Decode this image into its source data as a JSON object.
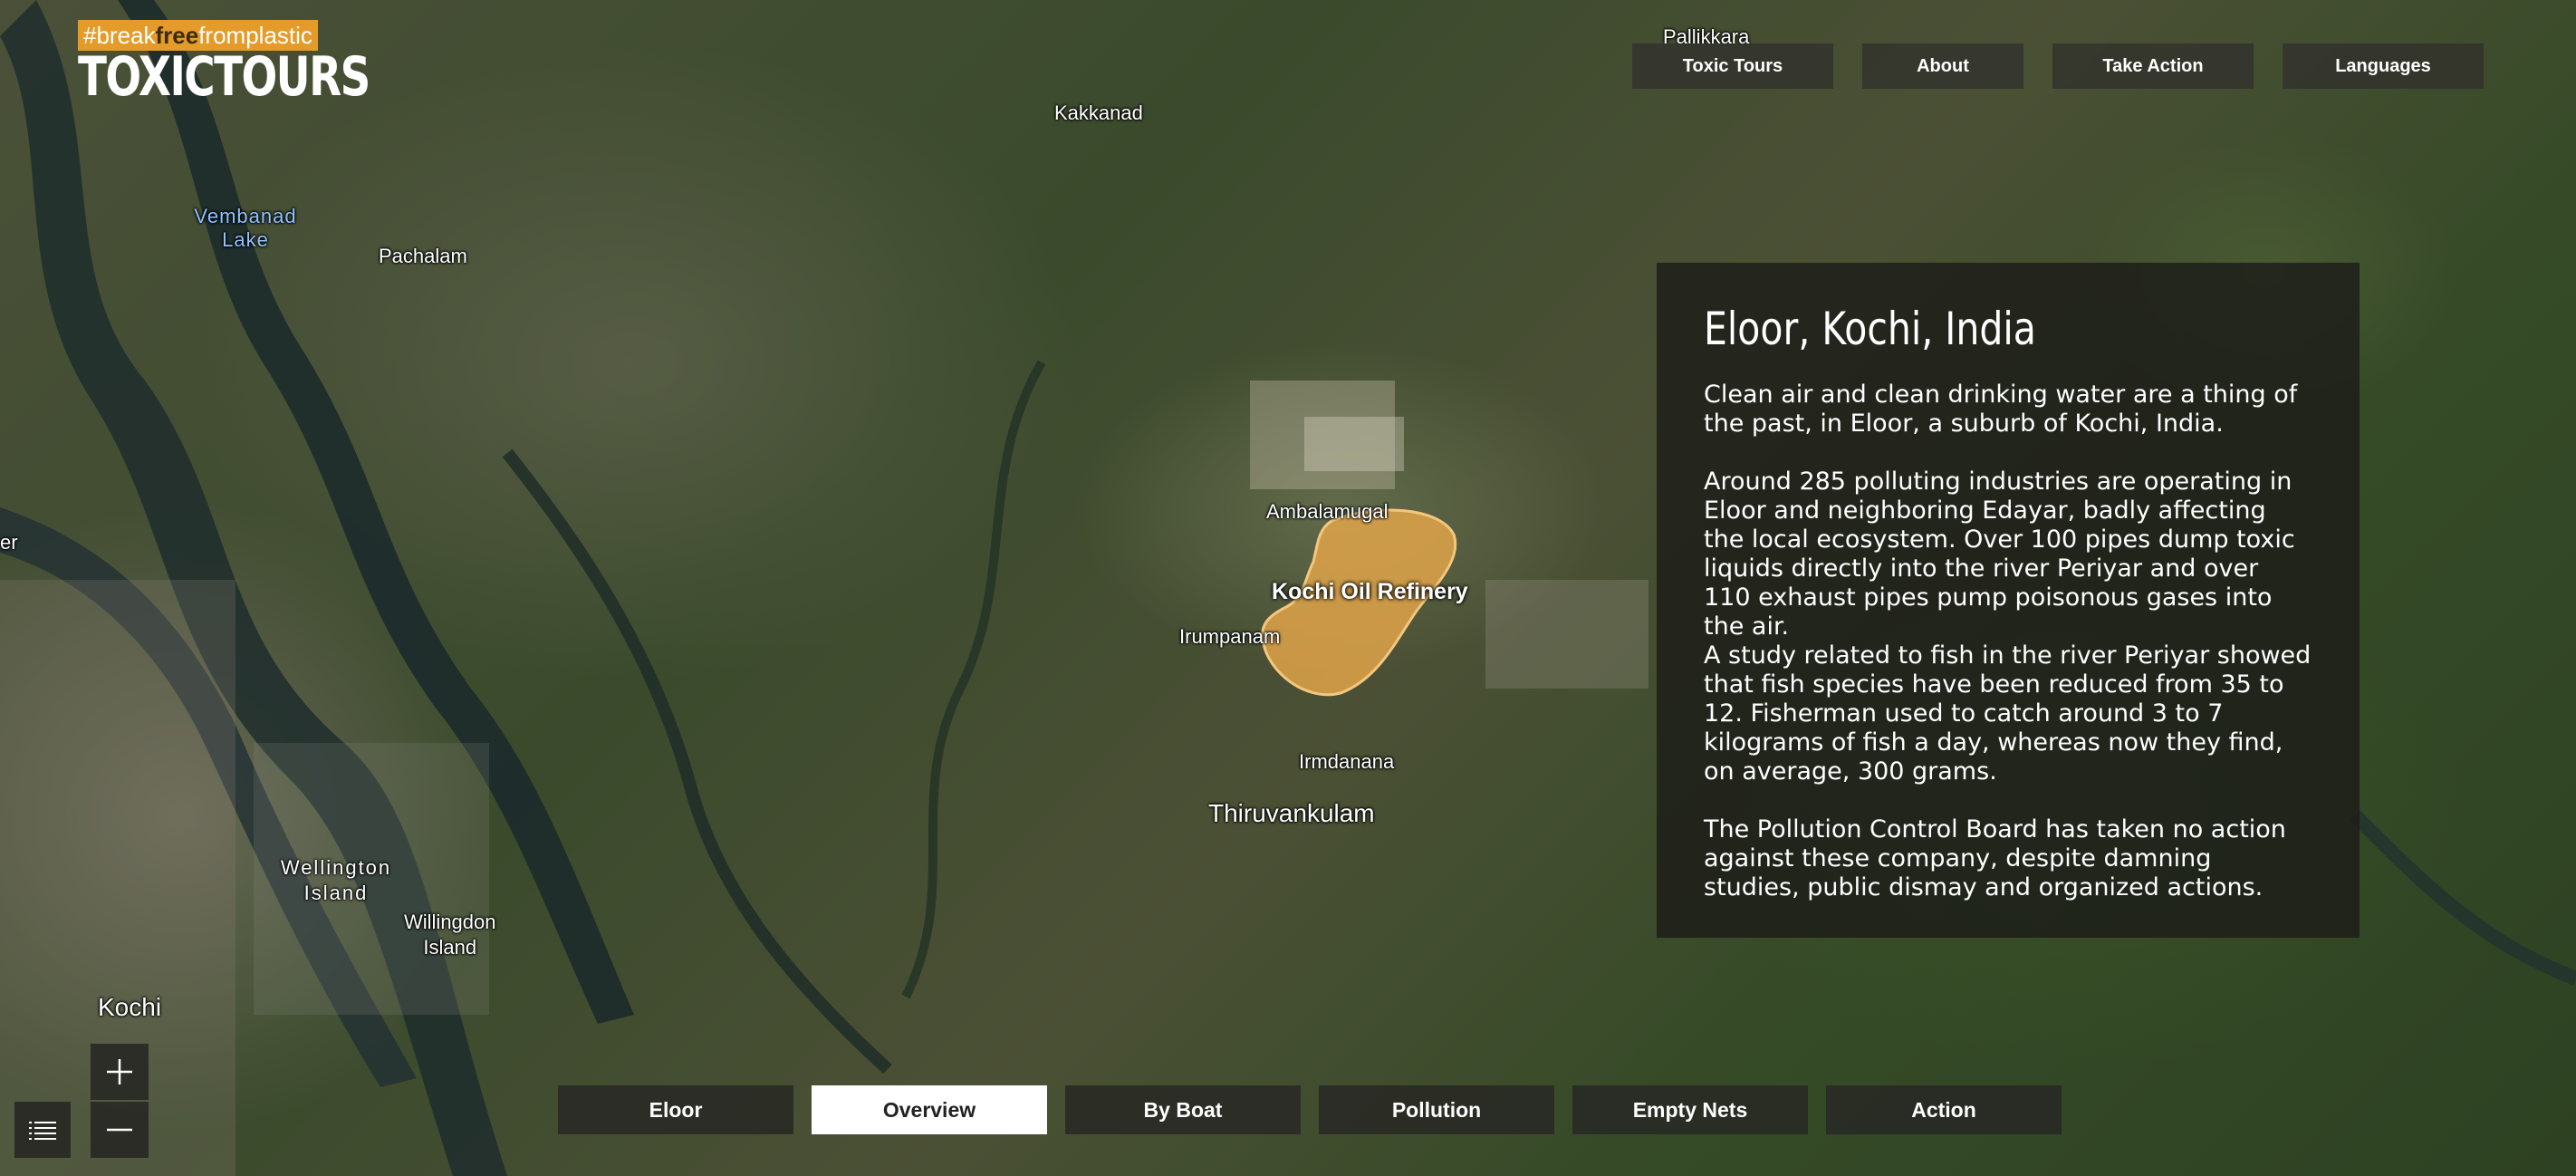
{
  "logo": {
    "tag_pre": "#break",
    "tag_free": "free",
    "tag_post": "fromplastic",
    "title": "TOXICTOURS"
  },
  "topnav": [
    {
      "label": "Toxic Tours"
    },
    {
      "label": "About"
    },
    {
      "label": "Take Action"
    },
    {
      "label": "Languages"
    }
  ],
  "map_labels": {
    "pallikkara": "Pallikkara",
    "kakkanad": "Kakkanad",
    "vembanad_1": "Vembanad",
    "vembanad_2": "Lake",
    "pachalam": "Pachalam",
    "ambalamugal": "Ambalamugal",
    "refinery": "Kochi Oil Refinery",
    "irumpanam": "Irumpanam",
    "irmdanana": "Irmdanana",
    "thiruvankulam": "Thiruvankulam",
    "wellington_1": "Wellington",
    "wellington_2": "Island",
    "willingdon_1": "Willingdon",
    "willingdon_2": "Island",
    "kochi": "Kochi",
    "edge_left": "er"
  },
  "panel": {
    "title": "Eloor, Kochi, India",
    "p1": "Clean air and clean drinking water are a thing of the past, in Eloor, a suburb of Kochi, India.",
    "p2": "Around 285 polluting industries are operating in Eloor and neighboring Edayar, badly affecting the local ecosystem. Over 100 pipes dump toxic liquids directly into the river Periyar and over 110 exhaust pipes pump poisonous gases into the air.",
    "p3": "A study related to fish in the river Periyar showed that fish species have been reduced from 35 to 12. Fisherman used to catch around 3 to 7 kilograms of fish a day, whereas now they find, on average, 300 grams.",
    "p4": "The Pollution Control Board has taken no action against these company, despite damning studies, public dismay and organized actions."
  },
  "tabs": [
    {
      "label": "Eloor",
      "active": false
    },
    {
      "label": "Overview",
      "active": true
    },
    {
      "label": "By Boat",
      "active": false
    },
    {
      "label": "Pollution",
      "active": false
    },
    {
      "label": "Empty Nets",
      "active": false
    },
    {
      "label": "Action",
      "active": false
    }
  ],
  "controls": {
    "zoom_in_icon": "plus-icon",
    "zoom_out_icon": "minus-icon",
    "list_icon": "list-icon"
  },
  "colors": {
    "brand_orange": "#e49b2a",
    "refinery_fill": "#e8a94a",
    "water_label": "#8fc3ff"
  }
}
